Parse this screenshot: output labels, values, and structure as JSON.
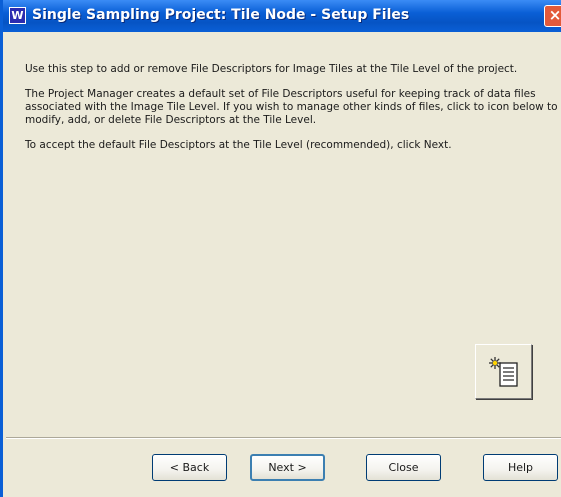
{
  "window": {
    "title": "Single Sampling Project: Tile Node - Setup Files",
    "app_icon_letter": "W",
    "close_glyph": "×"
  },
  "content": {
    "paragraph1": "Use this step to add or remove File Descriptors for Image Tiles at the Tile Level of the project.",
    "paragraph2": "The Project Manager creates a default set of File Descriptors useful for keeping track of data files associated with the Image Tile Level. If you wish to manage other kinds of files, click to icon below to modify, add, or delete File Descriptors at the Tile Level.",
    "paragraph3": "To accept the default File Desciptors at the Tile Level (recommended), click Next."
  },
  "icon_button": {
    "icon": "new-file-descriptor-icon"
  },
  "buttons": {
    "back": "< Back",
    "next": "Next >",
    "close": "Close",
    "help": "Help"
  },
  "colors": {
    "titlebar": "#0a5fd6",
    "dialog_bg": "#ece9d8",
    "close_button": "#e35a3a"
  }
}
